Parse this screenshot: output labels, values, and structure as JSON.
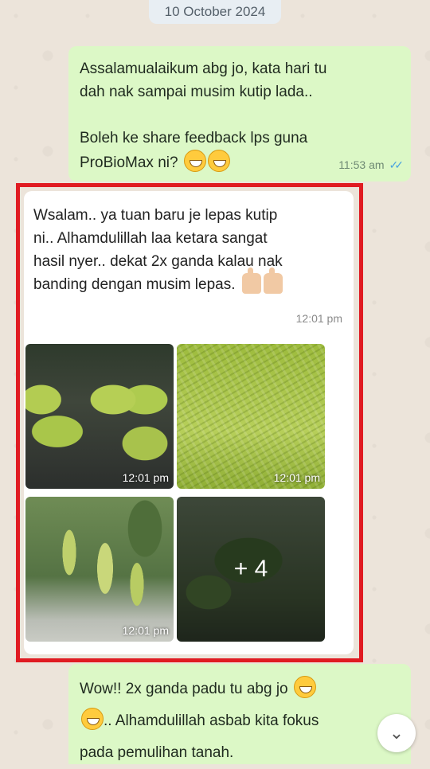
{
  "date_chip": "10 October 2024",
  "outgoing_1": {
    "line1": "Assalamualaikum abg jo, kata hari tu",
    "line2": "dah nak sampai musim kutip lada..",
    "line3": "Boleh ke share feedback lps guna",
    "line4": "ProBioMax ni?",
    "time": "11:53 am",
    "status_icon": "double-check-read"
  },
  "incoming": {
    "line1": "Wsalam.. ya tuan baru je lepas kutip",
    "line2": "ni.. Alhamdulillah laa ketara sangat",
    "line3": "hasil nyer.. dekat 2x ganda kalau nak",
    "line4": "banding dengan musim lepas.",
    "time": "12:01 pm",
    "photos": [
      {
        "time": "12:01 pm"
      },
      {
        "time": "12:01 pm"
      },
      {
        "time": "12:01 pm"
      },
      {
        "more_label": "+ 4"
      }
    ]
  },
  "outgoing_2": {
    "line1": "Wow!! 2x ganda padu tu abg jo",
    "line2": ".. Alhamdulillah asbab kita fokus",
    "line3": "pada pemulihan tanah."
  },
  "colors": {
    "outgoing_bubble": "#dcf8c6",
    "incoming_bubble": "#ffffff",
    "highlight_frame": "#e01b22",
    "read_ticks": "#4aa3df"
  }
}
